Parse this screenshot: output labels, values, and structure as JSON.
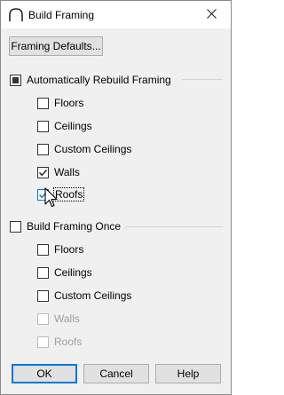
{
  "window": {
    "title": "Build Framing",
    "close_icon": "close-icon",
    "app_icon": "arc-framing-icon"
  },
  "framing_defaults_label": "Framing Defaults...",
  "auto_rebuild": {
    "label": "Automatically Rebuild Framing",
    "state": "indeterminate",
    "items": [
      {
        "label": "Floors",
        "checked": false,
        "disabled": false
      },
      {
        "label": "Ceilings",
        "checked": false,
        "disabled": false
      },
      {
        "label": "Custom Ceilings",
        "checked": false,
        "disabled": false
      },
      {
        "label": "Walls",
        "checked": true,
        "disabled": false
      },
      {
        "label": "Roofs",
        "checked": true,
        "disabled": false,
        "focused": true
      }
    ]
  },
  "build_once": {
    "label": "Build Framing Once",
    "state": "unchecked",
    "items": [
      {
        "label": "Floors",
        "checked": false,
        "disabled": false
      },
      {
        "label": "Ceilings",
        "checked": false,
        "disabled": false
      },
      {
        "label": "Custom Ceilings",
        "checked": false,
        "disabled": false
      },
      {
        "label": "Walls",
        "checked": false,
        "disabled": true
      },
      {
        "label": "Roofs",
        "checked": false,
        "disabled": true
      }
    ]
  },
  "buttons": {
    "ok": "OK",
    "cancel": "Cancel",
    "help": "Help"
  },
  "colors": {
    "accent": "#0078d7",
    "dialog_bg": "#f0f0f0",
    "disabled_text": "#a0a0a0"
  }
}
